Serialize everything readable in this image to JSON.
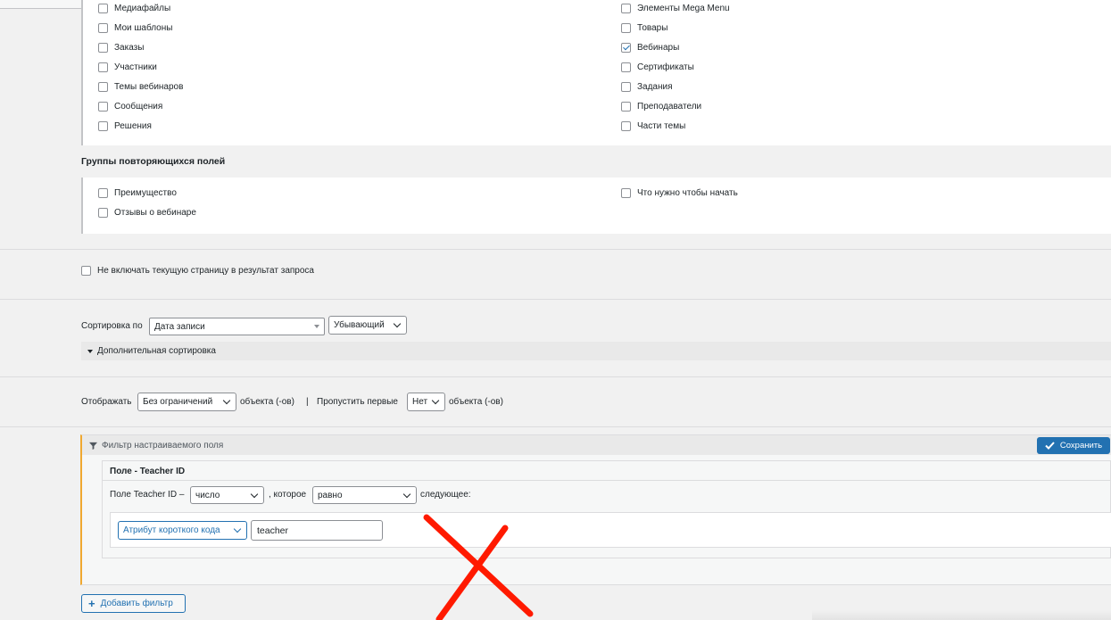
{
  "post_types_left": [
    {
      "label": "Медиафайлы",
      "checked": false
    },
    {
      "label": "Мои шаблоны",
      "checked": false
    },
    {
      "label": "Заказы",
      "checked": false
    },
    {
      "label": "Участники",
      "checked": false
    },
    {
      "label": "Темы вебинаров",
      "checked": false
    },
    {
      "label": "Сообщения",
      "checked": false
    },
    {
      "label": "Решения",
      "checked": false
    }
  ],
  "post_types_right": [
    {
      "label": "Элементы Mega Menu",
      "checked": false
    },
    {
      "label": "Товары",
      "checked": false
    },
    {
      "label": "Вебинары",
      "checked": true
    },
    {
      "label": "Сертификаты",
      "checked": false
    },
    {
      "label": "Задания",
      "checked": false
    },
    {
      "label": "Преподаватели",
      "checked": false
    },
    {
      "label": "Части темы",
      "checked": false
    }
  ],
  "repeater_groups": {
    "heading": "Группы повторяющихся полей",
    "left": [
      {
        "label": "Преимущество",
        "checked": false
      },
      {
        "label": "Отзывы о вебинаре",
        "checked": false
      }
    ],
    "right": [
      {
        "label": "Что нужно чтобы начать",
        "checked": false
      }
    ]
  },
  "exclude_current": {
    "label": "Не включать текущую страницу в результат запроса",
    "checked": false
  },
  "sorting": {
    "label": "Сортировка по",
    "field": "Дата записи",
    "order": "Убывающий",
    "additional": "Дополнительная сортировка"
  },
  "display": {
    "label": "Отображать",
    "limit": "Без ограничений",
    "objects_label": "объекта (-ов)",
    "separator": "|",
    "skip_label": "Пропустить первые",
    "skip_value": "Нет",
    "skip_objects_label": "объекта (-ов)"
  },
  "filter_panel": {
    "title": "Фильтр настраиваемого поля",
    "save_label": "Сохранить",
    "field_title": "Поле - Teacher ID",
    "field_prefix": "Поле Teacher ID –",
    "type_value": "число",
    "which_label": ", которое",
    "comparison_value": "равно",
    "following_label": "следующее:",
    "source_value": "Атрибут короткого кода",
    "attribute_value": "teacher"
  },
  "add_filter_label": "Добавить фильтр",
  "colors": {
    "accent": "#2271b1",
    "annotation": "#ff1a00",
    "panel_border": "#f0a830"
  }
}
